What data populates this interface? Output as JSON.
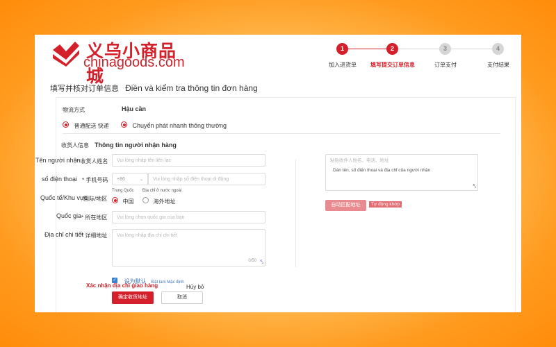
{
  "header": {
    "logo_cn": "义乌小商品城",
    "logo_en": "chinagoods.com"
  },
  "steps": [
    {
      "num": "1",
      "label": "加入进货单"
    },
    {
      "num": "2",
      "label": "填写提交订单信息"
    },
    {
      "num": "3",
      "label": "订单支付"
    },
    {
      "num": "4",
      "label": "支付结果"
    }
  ],
  "page_title": {
    "cn": "填写并核对订单信息",
    "vi": "Điền và kiểm tra thông tin đơn hàng"
  },
  "logistics": {
    "label_cn": "物流方式",
    "label_vi": "Hậu cần",
    "option_cn": "普通配送 快递",
    "option_vi": "Chuyển phát nhanh thông thường"
  },
  "recipient": {
    "section_cn": "收货人信息",
    "section_vi": "Thông tin người nhận hàng",
    "name_label_vi": "Tên người nhận",
    "name_label_cn": "* 收货人姓名",
    "name_placeholder": "Vui lòng nhập tên liên lạc",
    "phone_label_vi": "số điện thoại",
    "phone_label_cn": "* 手机号码",
    "phone_code": "+86",
    "phone_placeholder": "Vui lòng nhập số điện thoại di động",
    "region_label_vi": "Quốc tế/Khu vực",
    "region_label_cn": "国际/地区",
    "region_opt1_vi": "Trung Quốc",
    "region_opt1_cn": "中国",
    "region_opt2_vi": "Địa chỉ ở nước ngoài",
    "region_opt2_cn": "海外地址",
    "country_label_vi": "Quốc gia",
    "country_label_cn": "* 所在地区",
    "country_placeholder": "Vui lòng chọn quốc gia của bạn",
    "address_label_vi": "Địa chỉ chi tiết",
    "address_label_cn": "* 详细地址",
    "address_placeholder": "Vui lòng nhập địa chỉ chi tiết",
    "address_counter": "0/50",
    "default_cn": "设为默认",
    "default_vi": "Đặt làm Mặc định",
    "confirm_vi": "Xác nhận địa chỉ giao hàng",
    "cancel_vi": "Hủy bỏ",
    "confirm_btn": "确定收货地址",
    "cancel_btn": "取消"
  },
  "smart_paste": {
    "placeholder_cn": "粘贴收件人姓名、电话、地址",
    "placeholder_vi": "Dán tên, số điện thoại và địa chỉ của người nhận",
    "button_cn": "自动匹配地址",
    "button_vi": "Tự động khớp"
  },
  "colors": {
    "accent": "#d4202a",
    "background_orange": "#ff9b1f"
  }
}
